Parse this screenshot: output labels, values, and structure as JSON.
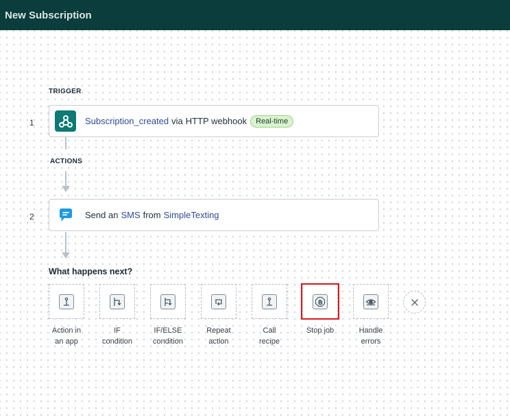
{
  "header": {
    "title": "New Subscription"
  },
  "trigger": {
    "section_label": "TRIGGER",
    "step_number": "1",
    "event": "Subscription_created",
    "via": "via",
    "app": "HTTP webhook",
    "badge": "Real-time",
    "icon": "webhook-icon"
  },
  "actions": {
    "section_label": "ACTIONS",
    "steps": [
      {
        "step_number": "2",
        "prefix": "Send an",
        "action": "SMS",
        "from": "from",
        "app": "SimpleTexting",
        "icon": "simpletexting-icon"
      }
    ]
  },
  "next": {
    "title": "What happens next?",
    "options": [
      {
        "label": "Action in\nan app",
        "icon": "action-icon"
      },
      {
        "label": "IF\ncondition",
        "icon": "if-condition-icon"
      },
      {
        "label": "IF/ELSE\ncondition",
        "icon": "if-else-condition-icon"
      },
      {
        "label": "Repeat\naction",
        "icon": "repeat-icon"
      },
      {
        "label": "Call\nrecipe",
        "icon": "call-recipe-icon"
      },
      {
        "label": "Stop job",
        "icon": "stop-hand-icon"
      },
      {
        "label": "Handle\nerrors",
        "icon": "eye-icon"
      }
    ],
    "selected_option": "Stop job"
  },
  "colors": {
    "header_bg": "#0a3d3b",
    "link": "#2d4b9b",
    "highlight": "#e0161b",
    "badge_bg": "#d9f2cf",
    "webhook_icon_bg": "#0e7a74",
    "sms_icon": "#1a9be0"
  }
}
